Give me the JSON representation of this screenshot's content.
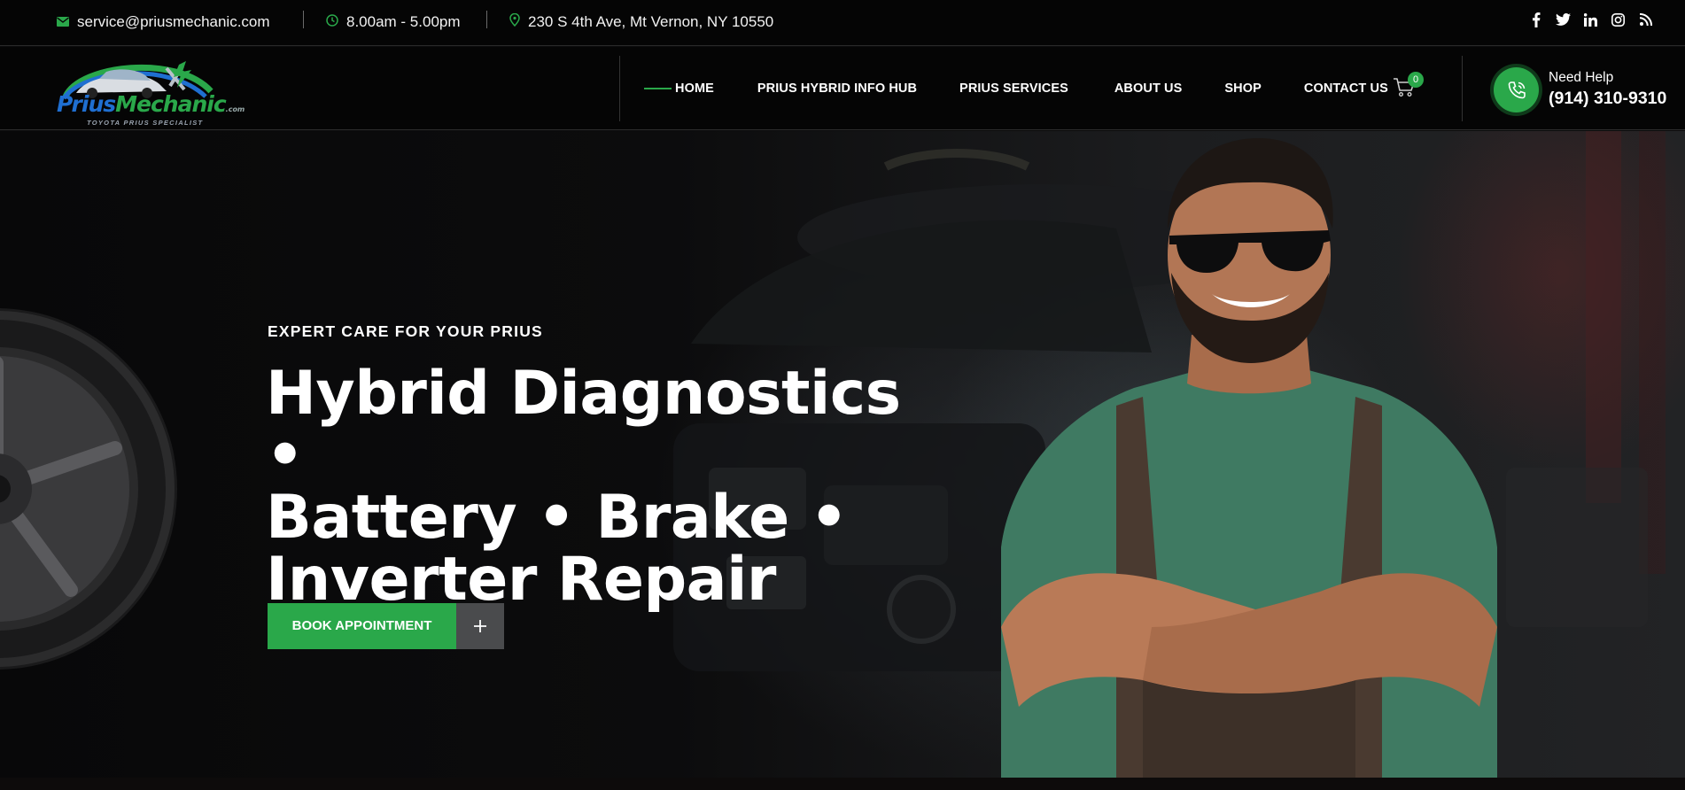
{
  "topbar": {
    "email": "service@priusmechanic.com",
    "hours": "8.00am - 5.00pm",
    "address": "230 S 4th Ave, Mt Vernon, NY 10550",
    "social_icons": [
      "facebook-icon",
      "twitter-icon",
      "linkedin-icon",
      "instagram-icon",
      "rss-icon"
    ]
  },
  "brand": {
    "logo_part1": "Prius",
    "logo_part2": "Mechanic",
    "logo_suffix": ".com",
    "logo_tagline": "TOYOTA PRIUS SPECIALIST"
  },
  "nav": {
    "items": [
      {
        "label": "HOME"
      },
      {
        "label": "PRIUS HYBRID INFO HUB"
      },
      {
        "label": "PRIUS SERVICES"
      },
      {
        "label": "ABOUT US"
      },
      {
        "label": "SHOP"
      },
      {
        "label": "CONTACT US"
      }
    ],
    "cart_count": "0",
    "help_label": "Need Help",
    "help_phone": "(914) 310-9310"
  },
  "hero": {
    "eyebrow": "EXPERT CARE FOR YOUR PRIUS",
    "headline_line1": "Hybrid Diagnostics •",
    "headline_line2": "Battery • Brake •",
    "headline_line3": "Inverter Repair",
    "cta_label": "BOOK APPOINTMENT"
  },
  "colors": {
    "accent_green": "#2aa84a",
    "topbar_bg": "#050505",
    "cta_secondary": "#4a4b4d"
  }
}
